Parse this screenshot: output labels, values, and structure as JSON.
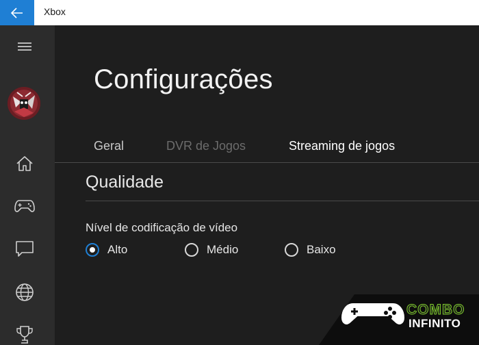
{
  "titlebar": {
    "app_title": "Xbox"
  },
  "sidebar": {
    "items": [
      {
        "name": "menu",
        "icon": "hamburger-icon"
      },
      {
        "name": "profile",
        "icon": "avatar"
      },
      {
        "name": "home",
        "icon": "home-icon"
      },
      {
        "name": "games",
        "icon": "gamepad-icon"
      },
      {
        "name": "messages",
        "icon": "chat-icon"
      },
      {
        "name": "network",
        "icon": "globe-icon"
      },
      {
        "name": "achievements",
        "icon": "trophy-icon"
      }
    ]
  },
  "main": {
    "page_title": "Configurações",
    "tabs": [
      {
        "label": "Geral",
        "state": "inactive"
      },
      {
        "label": "DVR de Jogos",
        "state": "disabled"
      },
      {
        "label": "Streaming de jogos",
        "state": "active"
      }
    ],
    "section_title": "Qualidade",
    "setting": {
      "label": "Nível de codificação de vídeo",
      "options": [
        {
          "label": "Alto",
          "selected": true
        },
        {
          "label": "Médio",
          "selected": false
        },
        {
          "label": "Baixo",
          "selected": false
        }
      ]
    }
  },
  "watermark": {
    "line1": "COMBO",
    "line2": "INFINITO"
  },
  "colors": {
    "accent": "#1f7fd4",
    "sidebar_bg": "#2c2c2c",
    "main_bg": "#1e1e1e",
    "watermark_green": "#7fcf2a"
  }
}
